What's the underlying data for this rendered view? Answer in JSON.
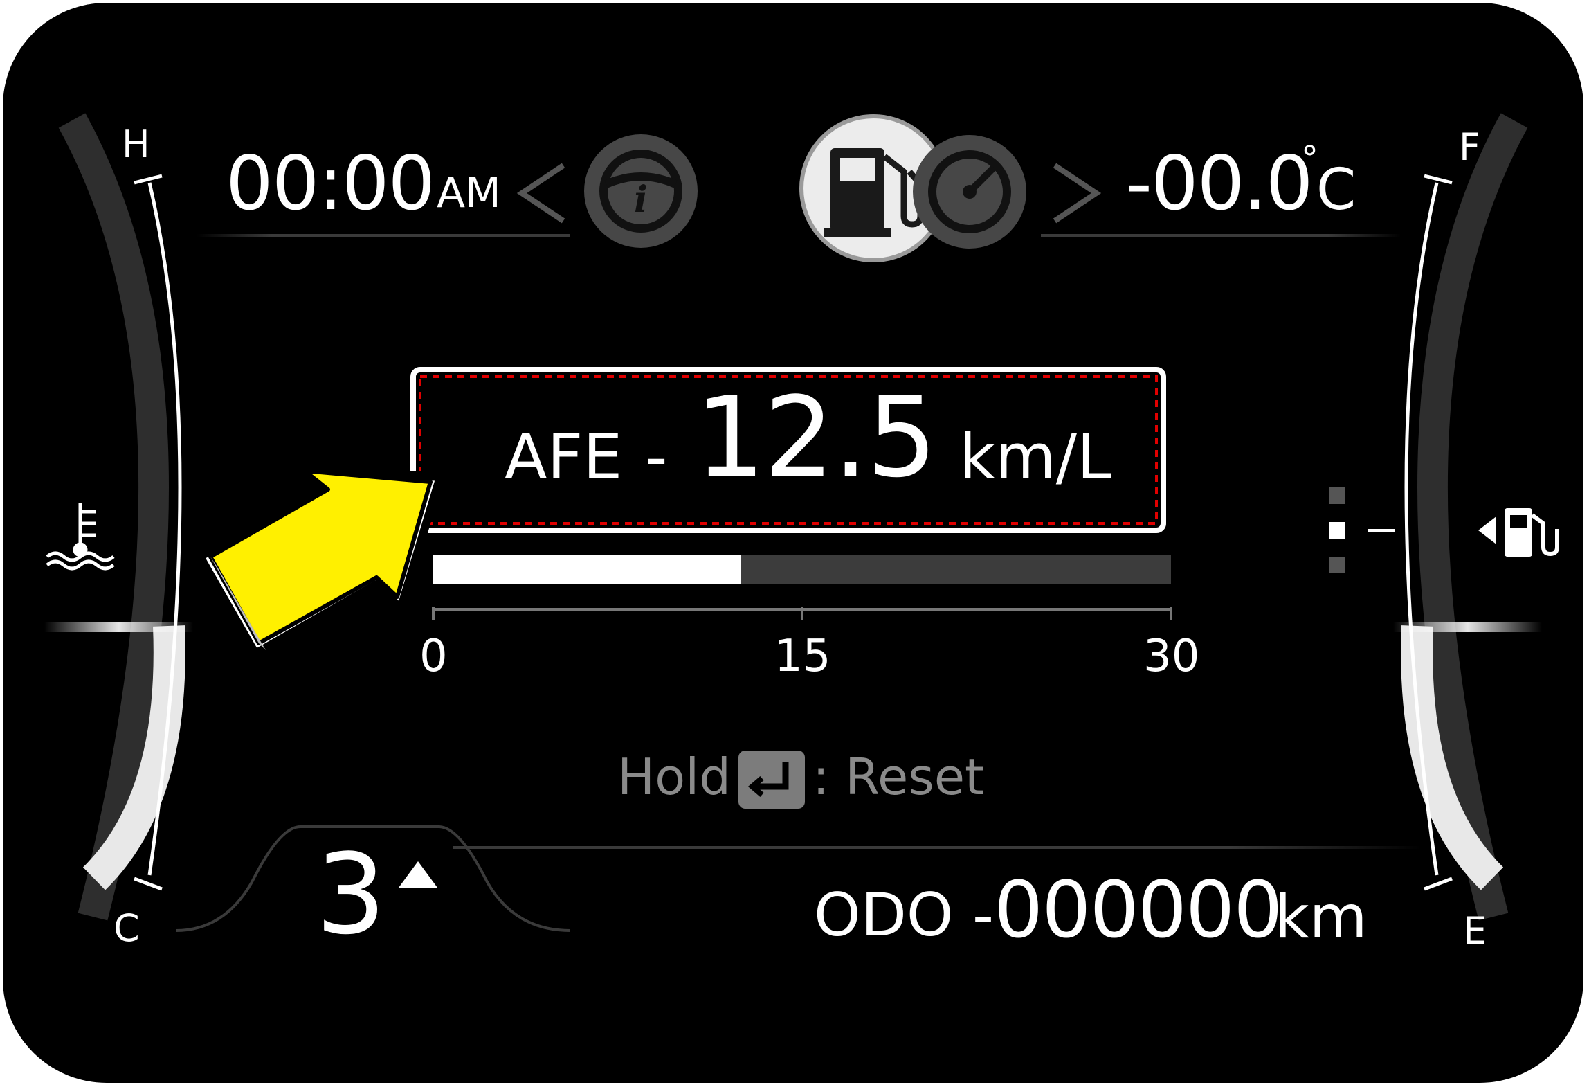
{
  "top_bar": {
    "clock": "00:00",
    "clock_ampm": "AM",
    "outside_temp": "-00.0",
    "outside_temp_degree": "°",
    "outside_temp_unit": "C"
  },
  "menu_icons": [
    {
      "name": "trip-info-icon"
    },
    {
      "name": "fuel-pump-icon",
      "selected": true
    },
    {
      "name": "speedometer-icon"
    }
  ],
  "temp_gauge": {
    "high_label": "H",
    "low_label": "C"
  },
  "fuel_gauge": {
    "full_label": "F",
    "empty_label": "E",
    "filler_side": "left"
  },
  "afe": {
    "label": "AFE",
    "separator": "-",
    "value": "12.5",
    "unit": "km/L",
    "bar": {
      "min": 0,
      "max": 30,
      "value": 12.5
    },
    "ticks": [
      "0",
      "15",
      "30"
    ]
  },
  "reset_hint": {
    "hold_label": "Hold",
    "reset_label": ": Reset"
  },
  "gear": {
    "value": "3",
    "indicator": "shift-up"
  },
  "odometer": {
    "label": "ODO -",
    "value": "000000",
    "unit": "km"
  },
  "colors": {
    "background": "#000000",
    "text": "#ffffff",
    "highlight_box": "#e00000",
    "callout_arrow": "#fff000",
    "dim_text": "#8a8a8a"
  }
}
